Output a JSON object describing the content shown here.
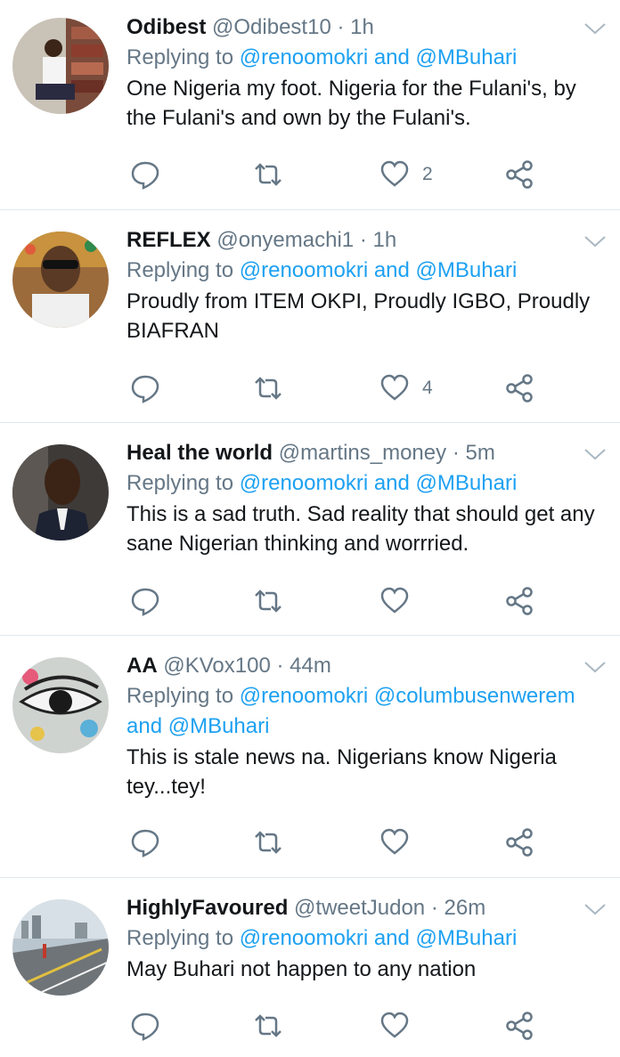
{
  "colors": {
    "link": "#1da1f2",
    "muted": "#657786",
    "text": "#14171a",
    "divider": "#e1e8ed"
  },
  "icons": {
    "reply": "reply-bubble-icon",
    "retweet": "retweet-arrows-icon",
    "like": "heart-icon",
    "share": "share-icon",
    "menu": "chevron-down-icon"
  },
  "tweets": [
    {
      "name": "Odibest",
      "handle": "@Odibest10",
      "dot": "·",
      "time": "1h",
      "replying_prefix": "Replying to",
      "mentions": "@renoomokri and @MBuhari",
      "text": "One Nigeria my foot. Nigeria for the Fulani's, by the Fulani's and own by the Fulani's.",
      "likes": "2"
    },
    {
      "name": "REFLEX",
      "handle": "@onyemachi1",
      "dot": "·",
      "time": "1h",
      "replying_prefix": "Replying to",
      "mentions": "@renoomokri and @MBuhari",
      "text": "Proudly from ITEM OKPI, Proudly IGBO, Proudly BIAFRAN",
      "likes": "4"
    },
    {
      "name": "Heal the world",
      "handle": "@martins_money",
      "dot": "·",
      "time": "5m",
      "replying_prefix": "Replying to",
      "mentions": "@renoomokri and @MBuhari",
      "text": "This is a sad truth. Sad reality that should get any sane Nigerian thinking and worrried.",
      "likes": ""
    },
    {
      "name": "AA",
      "handle": "@KVox100",
      "dot": "·",
      "time": "44m",
      "replying_prefix": "Replying to",
      "mentions": "@renoomokri @columbusenwerem and @MBuhari",
      "text": "This is stale news na. Nigerians know Nigeria tey...tey!",
      "likes": ""
    },
    {
      "name": "HighlyFavoured",
      "handle": "@tweetJudon",
      "dot": "·",
      "time": "26m",
      "replying_prefix": "Replying to",
      "mentions": "@renoomokri and @MBuhari",
      "text": "May Buhari not happen to any nation",
      "likes": ""
    }
  ]
}
